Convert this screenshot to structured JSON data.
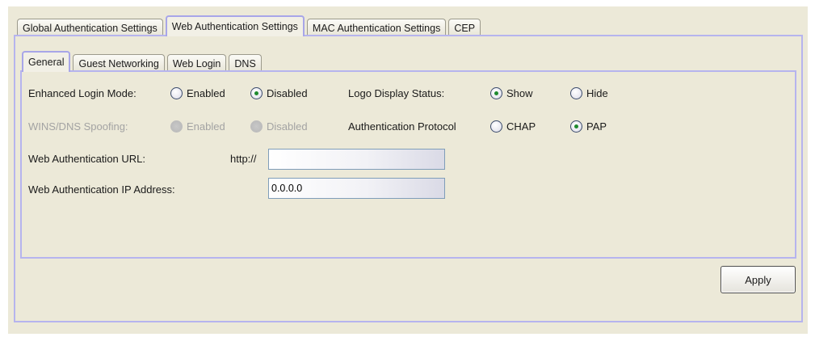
{
  "top_tabs": [
    {
      "label": "Global Authentication Settings",
      "active": false
    },
    {
      "label": "Web Authentication Settings",
      "active": true
    },
    {
      "label": "MAC Authentication Settings",
      "active": false
    },
    {
      "label": "CEP",
      "active": false
    }
  ],
  "sub_tabs": [
    {
      "label": "General",
      "active": true
    },
    {
      "label": "Guest Networking",
      "active": false
    },
    {
      "label": "Web Login",
      "active": false
    },
    {
      "label": "DNS",
      "active": false
    }
  ],
  "form": {
    "enhanced_login_mode": {
      "label": "Enhanced Login Mode:",
      "options": [
        "Enabled",
        "Disabled"
      ],
      "selected": "Disabled"
    },
    "logo_display_status": {
      "label": "Logo Display Status:",
      "options": [
        "Show",
        "Hide"
      ],
      "selected": "Show"
    },
    "wins_dns_spoofing": {
      "label": "WINS/DNS Spoofing:",
      "options": [
        "Enabled",
        "Disabled"
      ],
      "disabled": true
    },
    "authentication_protocol": {
      "label": "Authentication Protocol",
      "options": [
        "CHAP",
        "PAP"
      ],
      "selected": "PAP"
    },
    "web_auth_url": {
      "label": "Web Authentication URL:",
      "prefix": "http://",
      "value": ""
    },
    "web_auth_ip": {
      "label": "Web Authentication IP Address:",
      "value": "0.0.0.0"
    }
  },
  "apply_label": "Apply"
}
